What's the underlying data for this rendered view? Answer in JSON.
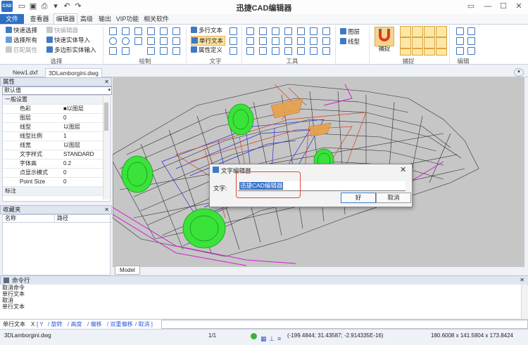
{
  "title": "迅捷CAD编辑器",
  "logo": "CAD",
  "menu": {
    "file": "文件",
    "tabs": [
      "查看器",
      "编辑器",
      "高级",
      "输出",
      "VIP功能",
      "相关软件"
    ]
  },
  "ribbon": {
    "select_items": [
      "快速选择",
      "选择所有",
      "匹配属性"
    ],
    "edit_items": [
      "快编辑器",
      "快速实体导入",
      "多边形实体输入"
    ],
    "text_items": [
      "多行文本",
      "单行文本",
      "属性定义"
    ],
    "layer_items": [
      "图层",
      "线型"
    ],
    "snap_label": "捕捉",
    "groups": {
      "select": "选择",
      "draw": "绘制",
      "text": "文字",
      "tools": "工具",
      "snap": "捕捉",
      "edit": "编辑"
    }
  },
  "doc_tabs": [
    "New1.dxf",
    "3DLamborgini.dwg"
  ],
  "properties": {
    "header": "属性",
    "selected": "默认值",
    "rows": [
      {
        "k": "一般设置",
        "v": ""
      },
      {
        "k": "色彩",
        "v": "■以图层"
      },
      {
        "k": "图层",
        "v": "0"
      },
      {
        "k": "线型",
        "v": "以图层"
      },
      {
        "k": "线型比例",
        "v": "1"
      },
      {
        "k": "线宽",
        "v": "以图层"
      },
      {
        "k": "文字样式",
        "v": "STANDARD"
      },
      {
        "k": "字体高",
        "v": "0.2"
      },
      {
        "k": "点显示模式",
        "v": "0"
      },
      {
        "k": "Point Size",
        "v": "0"
      },
      {
        "k": "标注",
        "v": ""
      }
    ]
  },
  "favorites": {
    "header": "收藏夹",
    "col_name": "名称",
    "col_path": "路径"
  },
  "model_tab": "Model",
  "dialog": {
    "title": "文字编辑器",
    "label": "文字:",
    "value": "迅捷CAD编辑器",
    "ok": "好",
    "cancel": "取消"
  },
  "command": {
    "header": "命令行",
    "log": [
      "取消命令",
      "单行文本",
      "取消",
      "单行文本"
    ],
    "prompt": "单行文本",
    "x": "X",
    "options": [
      "[ Y",
      "/ 旋转",
      "/ 高度",
      "/ 偏移",
      "/ 双重偏移",
      "/ 取消 ]"
    ]
  },
  "status": {
    "file": "3DLamborgini.dwg",
    "page": "1/1",
    "coords": "(-199.4844; 31.43587; -2.914335E-16)",
    "extent": "180.6008 x 141.5804 x 173.8424"
  },
  "colors": {
    "accent": "#2f6fc1",
    "canvas": "#c6c6c6",
    "dialog_highlight": "#e04a3a"
  }
}
